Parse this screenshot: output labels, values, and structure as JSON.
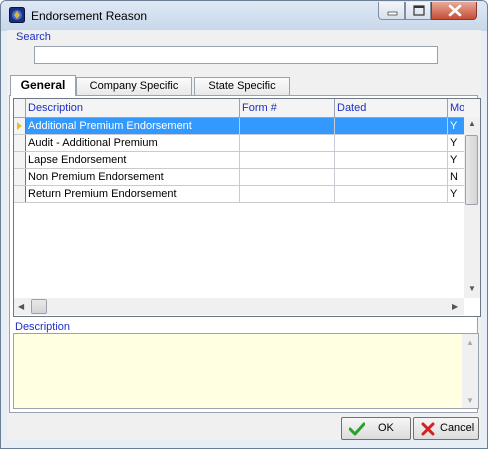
{
  "window": {
    "title": "Endorsement Reason"
  },
  "search": {
    "label": "Search",
    "value": ""
  },
  "tabs": [
    {
      "label": "General"
    },
    {
      "label": "Company Specific"
    },
    {
      "label": "State Specific"
    }
  ],
  "grid": {
    "columns": [
      "Description",
      "Form #",
      "Dated",
      "Mo"
    ],
    "rows": [
      {
        "description": "Additional Premium Endorsement",
        "form": "",
        "dated": "",
        "mo": "Y"
      },
      {
        "description": "Audit - Additional Premium",
        "form": "",
        "dated": "",
        "mo": "Y"
      },
      {
        "description": "Lapse Endorsement",
        "form": "",
        "dated": "",
        "mo": "Y"
      },
      {
        "description": "Non Premium Endorsement",
        "form": "",
        "dated": "",
        "mo": "N"
      },
      {
        "description": "Return Premium Endorsement",
        "form": "",
        "dated": "",
        "mo": "Y"
      }
    ]
  },
  "description_panel": {
    "label": "Description",
    "value": ""
  },
  "buttons": {
    "ok": "OK",
    "cancel": "Cancel"
  },
  "colors": {
    "selection": "#3399ff",
    "label_blue": "#1c30c4",
    "memo_bg": "#ffffe1"
  }
}
